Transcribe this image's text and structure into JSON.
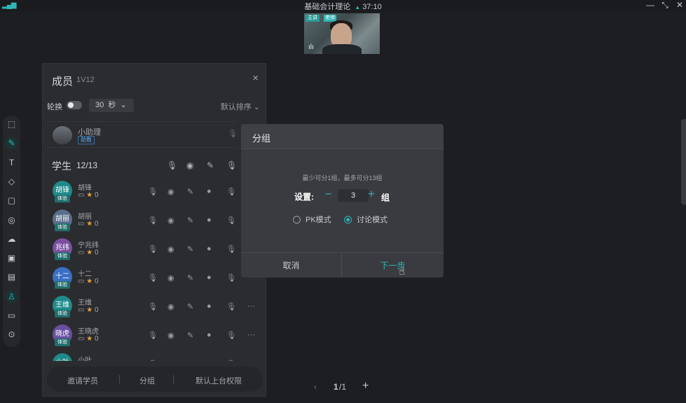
{
  "titlebar": {
    "title": "基础会计理论",
    "timer": "37:10",
    "signal_icon": "signal-icon",
    "minimize": "—",
    "restore": "⤡",
    "close": "✕"
  },
  "video": {
    "badge": "主讲",
    "badge2": "老师"
  },
  "toolbar": {
    "tools": [
      {
        "icon": "select-icon",
        "glyph": "⬚"
      },
      {
        "icon": "pen-icon",
        "glyph": "✎"
      },
      {
        "icon": "text-icon",
        "glyph": "T"
      },
      {
        "icon": "eraser-icon",
        "glyph": "◇"
      },
      {
        "icon": "shape-icon",
        "glyph": "▢"
      },
      {
        "icon": "pointer-icon",
        "glyph": "◎"
      },
      {
        "icon": "cloud-icon",
        "glyph": "☁"
      },
      {
        "icon": "image-icon",
        "glyph": "▣"
      },
      {
        "icon": "toolbox-icon",
        "glyph": "▤"
      },
      {
        "icon": "members-icon",
        "glyph": "♙"
      },
      {
        "icon": "chat-icon",
        "glyph": "▭"
      },
      {
        "icon": "settings-icon",
        "glyph": "⊙"
      }
    ]
  },
  "members": {
    "title": "成员",
    "subtitle": "1V12",
    "close": "×",
    "rotate_label": "轮换",
    "seconds_value": "30",
    "seconds_unit": "秒",
    "sort_label": "默认排序",
    "assistant": {
      "name": "小助理",
      "tag": "助教"
    },
    "students_label": "学生",
    "students_count": "12/13",
    "students": [
      {
        "avatar": "胡锋",
        "name": "胡锋",
        "badge": "体验",
        "stars": "0",
        "color": "#1f8a8a"
      },
      {
        "avatar": "胡丽",
        "name": "胡丽",
        "badge": "体验",
        "stars": "0",
        "color": "#5b6e8c"
      },
      {
        "avatar": "兆纬",
        "name": "宁兆纬",
        "badge": "体验",
        "stars": "0",
        "color": "#7a4fa0"
      },
      {
        "avatar": "十二",
        "name": "十二",
        "badge": "体验",
        "stars": "0",
        "color": "#3a6fc4"
      },
      {
        "avatar": "王维",
        "name": "王维",
        "badge": "体验",
        "stars": "0",
        "color": "#1f8a8a"
      },
      {
        "avatar": "晓虎",
        "name": "王晓虎",
        "badge": "体验",
        "stars": "0",
        "color": "#6a4fa0"
      },
      {
        "avatar": "小叶",
        "name": "小叶",
        "badge": "",
        "stars": "",
        "color": "#1f8a8a"
      }
    ],
    "more": "···",
    "bottom": {
      "invite": "邀请学员",
      "group": "分组",
      "permission": "默认上台权限"
    }
  },
  "dialog": {
    "title": "分组",
    "hint": "最少可分1组，最多可分13组",
    "set_label": "设置:",
    "minus": "−",
    "value": "3",
    "plus": "+",
    "unit": "组",
    "pk_mode": "PK模式",
    "discuss_mode": "讨论模式",
    "selected_mode": "讨论模式",
    "cancel": "取消",
    "next": "下一步"
  },
  "pager": {
    "prev": "‹",
    "current": "1",
    "total": "/1",
    "add": "+"
  },
  "colors": {
    "accent": "#2fb6b4",
    "background": "#1d1e22",
    "panel": "#2b2c30",
    "dialog": "#3a3b40"
  }
}
